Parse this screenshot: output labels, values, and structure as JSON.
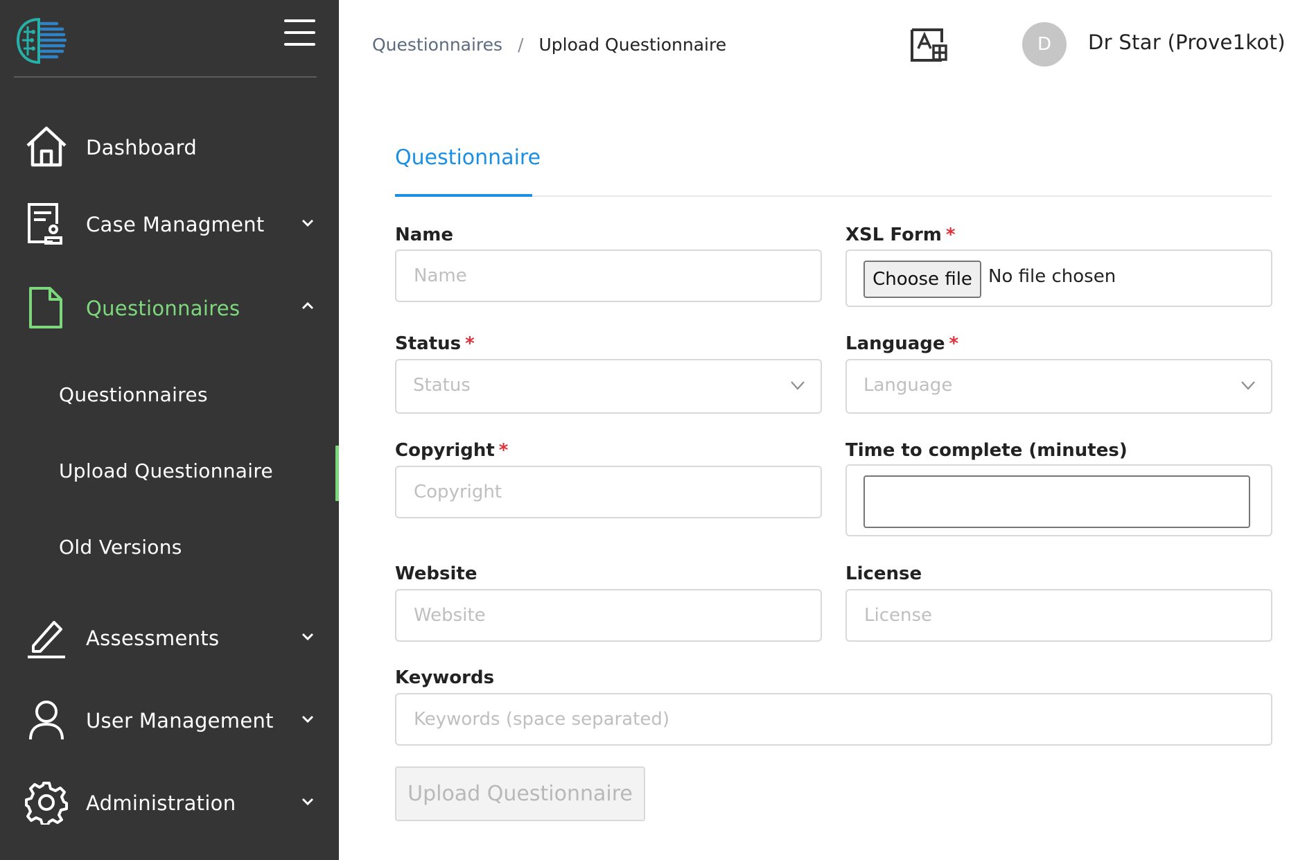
{
  "sidebar": {
    "nav": [
      {
        "label": "Dashboard",
        "icon": "home-icon"
      },
      {
        "label": "Case Managment",
        "icon": "case-file-icon"
      },
      {
        "label": "Questionnaires",
        "icon": "document-icon"
      },
      {
        "label": "Assessments",
        "icon": "pen-icon"
      },
      {
        "label": "User Management",
        "icon": "user-icon"
      },
      {
        "label": "Administration",
        "icon": "gear-icon"
      }
    ],
    "sub_items": [
      {
        "label": "Questionnaires"
      },
      {
        "label": "Upload Questionnaire"
      },
      {
        "label": "Old Versions"
      }
    ],
    "active_color": "#7dd87d"
  },
  "header": {
    "breadcrumb": {
      "parent": "Questionnaires",
      "separator": "/",
      "current": "Upload Questionnaire"
    },
    "avatar_initial": "D",
    "username": "Dr Star (Prove1kot)"
  },
  "tabs": [
    {
      "label": "Questionnaire",
      "active": true
    }
  ],
  "form": {
    "name": {
      "label": "Name",
      "placeholder": "Name",
      "required": false
    },
    "xsl_form": {
      "label": "XSL Form",
      "required": true,
      "button": "Choose file",
      "status": "No file chosen"
    },
    "status": {
      "label": "Status",
      "placeholder": "Status",
      "required": true
    },
    "language": {
      "label": "Language",
      "placeholder": "Language",
      "required": true
    },
    "copyright": {
      "label": "Copyright",
      "placeholder": "Copyright",
      "required": true
    },
    "time": {
      "label": "Time to complete (minutes)",
      "value": ""
    },
    "website": {
      "label": "Website",
      "placeholder": "Website"
    },
    "license": {
      "label": "License",
      "placeholder": "License"
    },
    "keywords": {
      "label": "Keywords",
      "placeholder": "Keywords (space separated)"
    },
    "required_mark": "*",
    "submit": "Upload Questionnaire"
  },
  "colors": {
    "sidebar_bg": "#353535",
    "accent": "#1a8fe3",
    "required": "#e0303a"
  }
}
